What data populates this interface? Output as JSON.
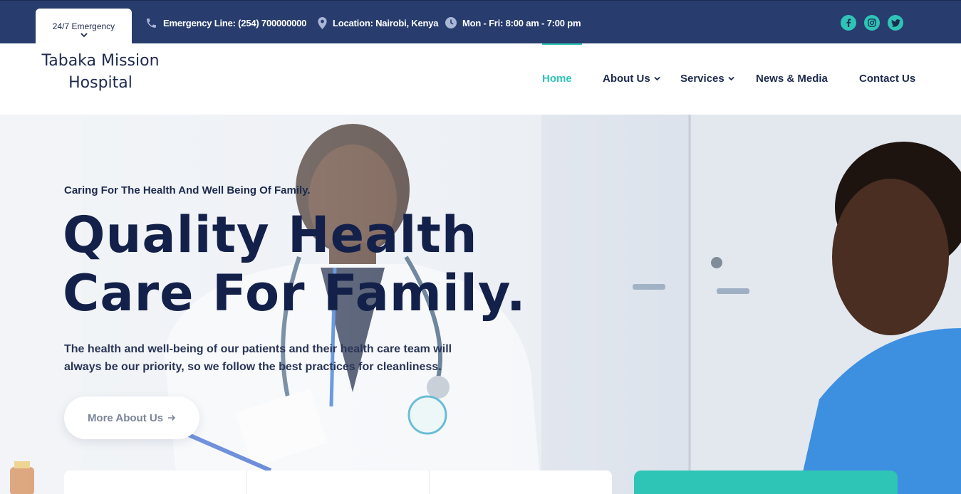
{
  "topbar": {
    "emergency_label": "24/7 Emergency",
    "emergency_line": "Emergency Line: (254) 700000000",
    "location": "Location: Nairobi, Kenya",
    "hours": "Mon - Fri: 8:00 am - 7:00 pm",
    "social": [
      "facebook-icon",
      "instagram-icon",
      "twitter-icon"
    ]
  },
  "header": {
    "logo_line1": "Tabaka Mission",
    "logo_line2": "Hospital",
    "nav": [
      {
        "label": "Home",
        "active": true
      },
      {
        "label": "About Us",
        "dropdown": true
      },
      {
        "label": "Services",
        "dropdown": true
      },
      {
        "label": "News & Media"
      },
      {
        "label": "Contact Us"
      }
    ]
  },
  "hero": {
    "tagline": "Caring For The Health And Well Being Of Family.",
    "headline_line1": "Quality Health",
    "headline_line2": "Care For Family.",
    "intro": "The health and well-being of our patients and their health care team will always be our priority, so we follow the best practices for cleanliness.",
    "cta_label": "More About Us"
  },
  "colors": {
    "navy": "#283c6e",
    "dark_text": "#1d2a4d",
    "accent": "#2ec4b6"
  }
}
